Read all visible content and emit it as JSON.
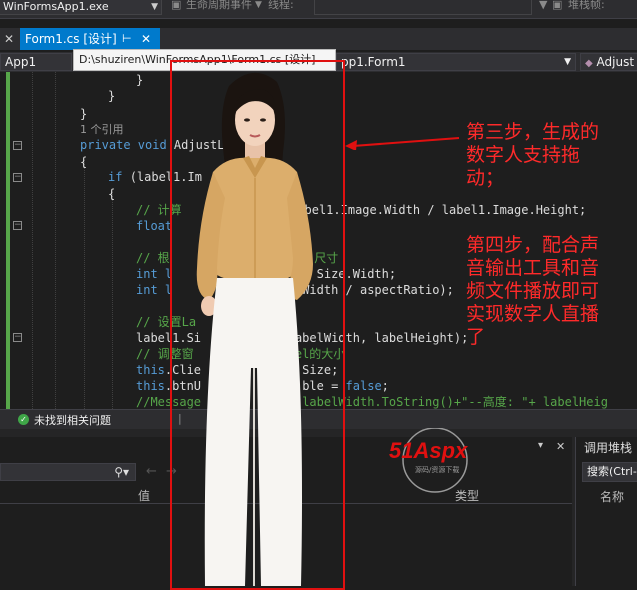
{
  "toolbar": {
    "exe_combo": "WinFormsApp1.exe",
    "lifecycle_label": "生命周期事件",
    "thread_label": "线程:",
    "stackframe_label": "堆栈帧:"
  },
  "tabs": [
    {
      "label": "Form1.cs [设计]",
      "active": false
    },
    {
      "label": "Form1.cs [设计]",
      "active": true
    }
  ],
  "tooltip": "D:\\shuziren\\WinFormsApp1\\Form1.cs [设计]",
  "nav": {
    "project": "App1",
    "class": "pp1.Form1",
    "member": "Adjust"
  },
  "code": {
    "lines": [
      {
        "indent": 5,
        "parts": [
          {
            "t": "}",
            "c": ""
          }
        ]
      },
      {
        "indent": 4,
        "parts": [
          {
            "t": "}",
            "c": ""
          }
        ]
      },
      {
        "indent": 3,
        "parts": [
          {
            "t": "}",
            "c": ""
          }
        ]
      },
      {
        "indent": 3,
        "parts": [
          {
            "t": "1 个引用",
            "c": "ref"
          }
        ]
      },
      {
        "indent": 3,
        "parts": [
          {
            "t": "private ",
            "c": "kw"
          },
          {
            "t": "void ",
            "c": "kw"
          },
          {
            "t": "AdjustL",
            "c": ""
          }
        ]
      },
      {
        "indent": 3,
        "parts": [
          {
            "t": "{",
            "c": ""
          }
        ]
      },
      {
        "indent": 4,
        "parts": [
          {
            "t": "if ",
            "c": "kw"
          },
          {
            "t": "(label1.Im",
            "c": ""
          }
        ]
      },
      {
        "indent": 4,
        "parts": [
          {
            "t": "{",
            "c": ""
          }
        ]
      },
      {
        "indent": 5,
        "parts": [
          {
            "t": "// 计算",
            "c": "cm"
          },
          {
            "t": "                ",
            "c": ""
          },
          {
            "t": "abel1.Image.Width / label1.Image.Height;",
            "c": ""
          }
        ]
      },
      {
        "indent": 5,
        "parts": [
          {
            "t": "float",
            "c": "kw"
          }
        ]
      },
      {
        "indent": 0,
        "parts": []
      },
      {
        "indent": 5,
        "parts": [
          {
            "t": "// 根",
            "c": "cm"
          },
          {
            "t": "                    ",
            "c": ""
          },
          {
            "t": "尺寸",
            "c": "cm"
          }
        ]
      },
      {
        "indent": 5,
        "parts": [
          {
            "t": "int l",
            "c": "kw"
          },
          {
            "t": "                    ",
            "c": ""
          },
          {
            "t": "Size.Width;",
            "c": ""
          }
        ]
      },
      {
        "indent": 5,
        "parts": [
          {
            "t": "int l",
            "c": "kw"
          },
          {
            "t": "                ",
            "c": ""
          },
          {
            "t": "elWidth / aspectRatio);",
            "c": ""
          }
        ]
      },
      {
        "indent": 0,
        "parts": []
      },
      {
        "indent": 5,
        "parts": [
          {
            "t": "// 设置La",
            "c": "cm"
          }
        ]
      },
      {
        "indent": 5,
        "parts": [
          {
            "t": "label1.Si",
            "c": ""
          },
          {
            "t": "             ",
            "c": ""
          },
          {
            "t": "abelWidth, labelHeight);",
            "c": ""
          }
        ]
      },
      {
        "indent": 5,
        "parts": [
          {
            "t": "// 调整窗",
            "c": "cm"
          },
          {
            "t": "            ",
            "c": ""
          },
          {
            "t": "abel的大小",
            "c": "cm"
          }
        ]
      },
      {
        "indent": 5,
        "parts": [
          {
            "t": "this",
            "c": "kw"
          },
          {
            "t": ".Clie",
            "c": ""
          },
          {
            "t": "             ",
            "c": ""
          },
          {
            "t": ".Size;",
            "c": ""
          }
        ]
      },
      {
        "indent": 5,
        "parts": [
          {
            "t": "this",
            "c": "kw"
          },
          {
            "t": ".btnU",
            "c": ""
          },
          {
            "t": "              ",
            "c": ""
          },
          {
            "t": "ble = ",
            "c": ""
          },
          {
            "t": "false",
            "c": "kw"
          },
          {
            "t": ";",
            "c": ""
          }
        ]
      },
      {
        "indent": 5,
        "parts": [
          {
            "t": "//Message",
            "c": "cm"
          },
          {
            "t": "           ",
            "c": ""
          },
          {
            "t": "\"+ labelWidth.ToString()+\"--高度: \"+ labelHeig",
            "c": "cm"
          }
        ]
      }
    ]
  },
  "status": {
    "issues": "未找到相关问题"
  },
  "bottom": {
    "search_placeholder": "",
    "col_value": "值",
    "col_type": "类型",
    "callstack_title": "调用堆栈",
    "search_hint": "搜索(Ctrl-",
    "col_name": "名称"
  },
  "annotations": {
    "step3_lines": [
      "第三步，生成的",
      "数字人支持拖",
      "动；"
    ],
    "step4_lines": [
      "第四步，配合声",
      "音输出工具和音",
      "频文件播放即可",
      "实现数字人直播",
      "了"
    ]
  },
  "watermark": {
    "brand": "51Aspx",
    "sub": "源码/资源下载"
  },
  "colors": {
    "accent": "#007acc",
    "annotation_red": "#ff2a2a",
    "editor_bg": "#1e1e1e"
  }
}
